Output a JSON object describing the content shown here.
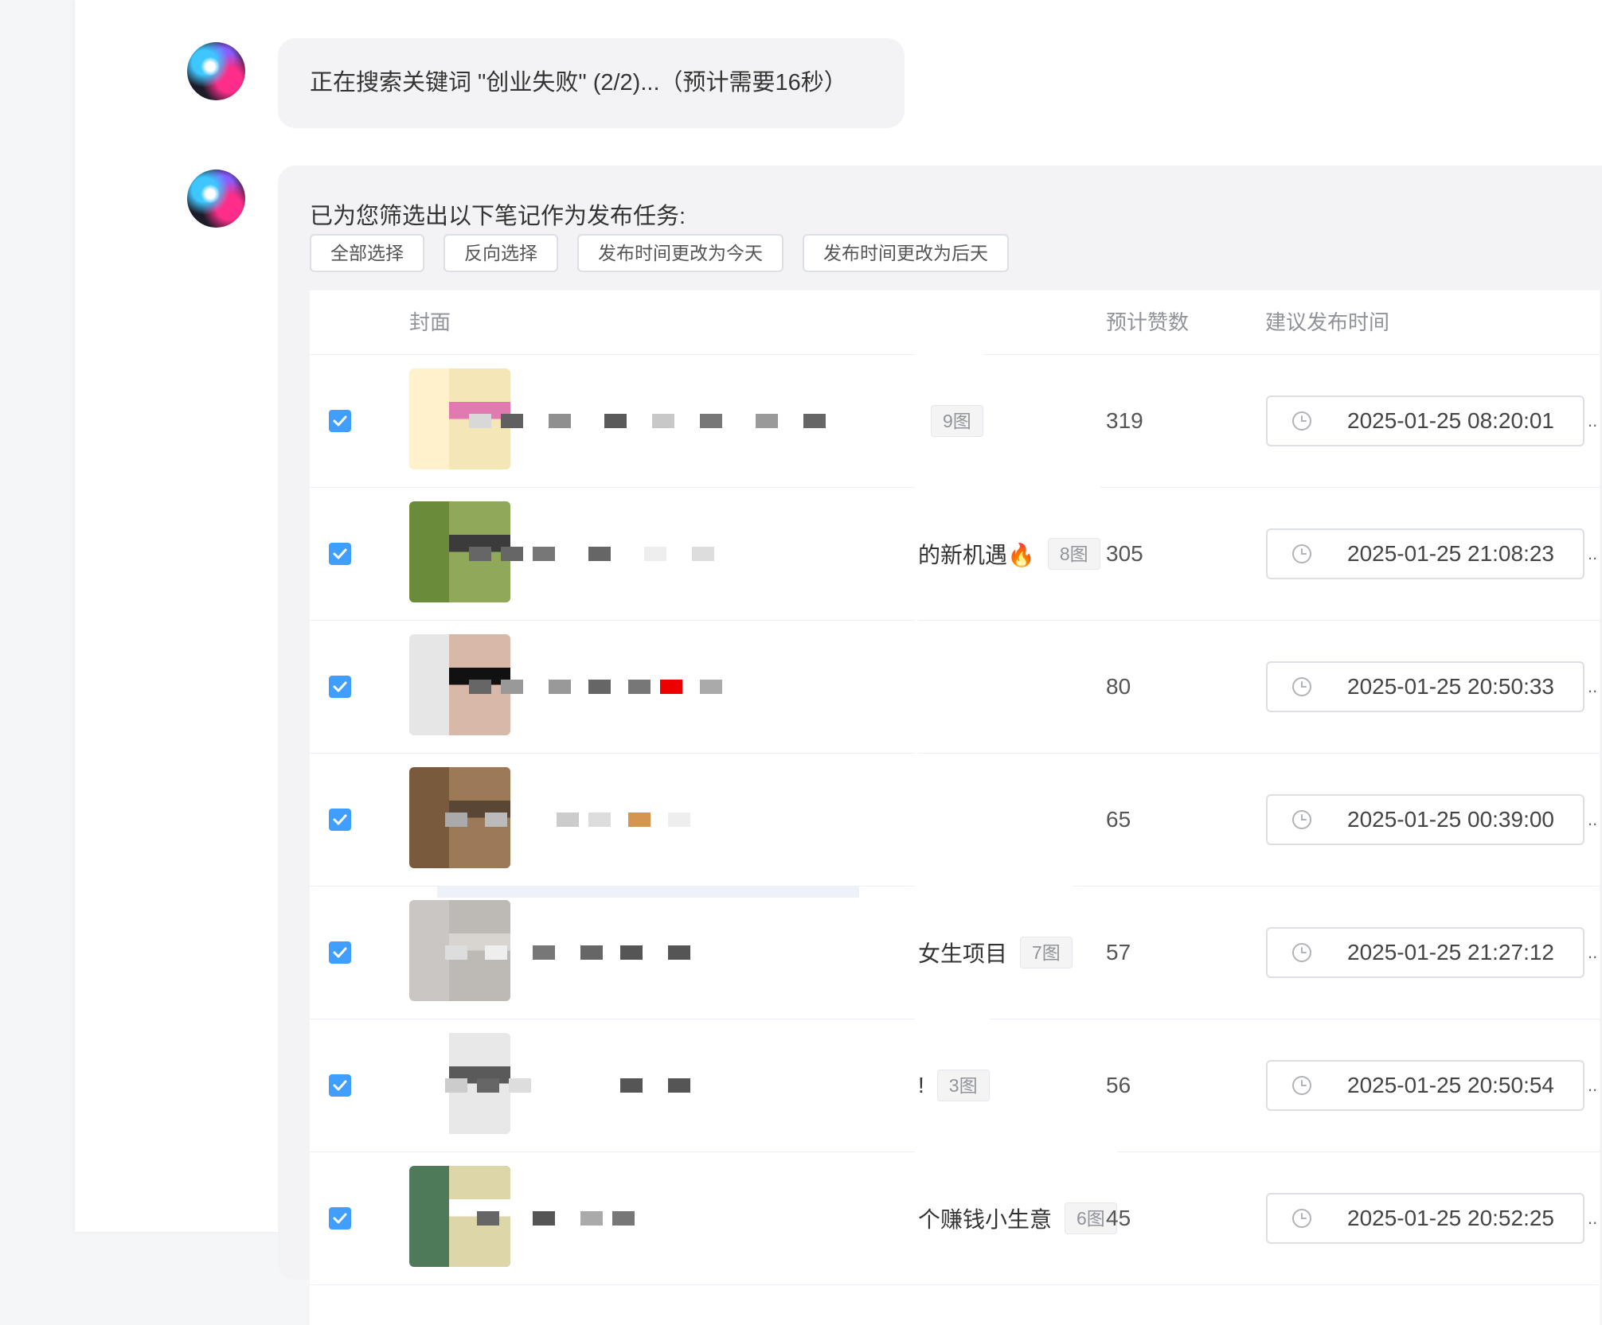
{
  "messages": {
    "status": "正在搜索关键词 \"创业失败\" (2/2)...（预计需要16秒）",
    "intro": "已为您筛选出以下笔记作为发布任务:"
  },
  "actions": [
    {
      "label": "全部选择"
    },
    {
      "label": "反向选择"
    },
    {
      "label": "发布时间更改为今天"
    },
    {
      "label": "发布时间更改为后天"
    }
  ],
  "table": {
    "headers": {
      "cover": "封面",
      "likes": "预计赞数",
      "time": "建议发布时间"
    },
    "rows": [
      {
        "checked": true,
        "title_visible": "",
        "images": "9图",
        "likes": "319",
        "time": "2025-01-25 08:20:01",
        "more": ".."
      },
      {
        "checked": true,
        "title_visible": "的新机遇🔥",
        "images": "8图",
        "likes": "305",
        "time": "2025-01-25 21:08:23",
        "more": ".."
      },
      {
        "checked": true,
        "title_visible": "",
        "images": "",
        "likes": "80",
        "time": "2025-01-25 20:50:33",
        "more": ".."
      },
      {
        "checked": true,
        "title_visible": "",
        "images": "",
        "likes": "65",
        "time": "2025-01-25 00:39:00",
        "more": ".."
      },
      {
        "checked": true,
        "title_visible": "女生项目",
        "images": "7图",
        "likes": "57",
        "time": "2025-01-25 21:27:12",
        "more": ".."
      },
      {
        "checked": true,
        "title_visible": "!",
        "images": "3图",
        "likes": "56",
        "time": "2025-01-25 20:50:54",
        "more": ".."
      },
      {
        "checked": true,
        "title_visible": "个赚钱小生意",
        "images": "6图",
        "likes": "45",
        "time": "2025-01-25 20:52:25",
        "more": ".."
      }
    ]
  },
  "colors": {
    "accent": "#409eff",
    "bubble": "#f3f3f5",
    "sidebar": "#f5f6f8"
  },
  "icons": [
    "assistant-avatar-icon",
    "checkbox-checked-icon",
    "clock-icon"
  ]
}
